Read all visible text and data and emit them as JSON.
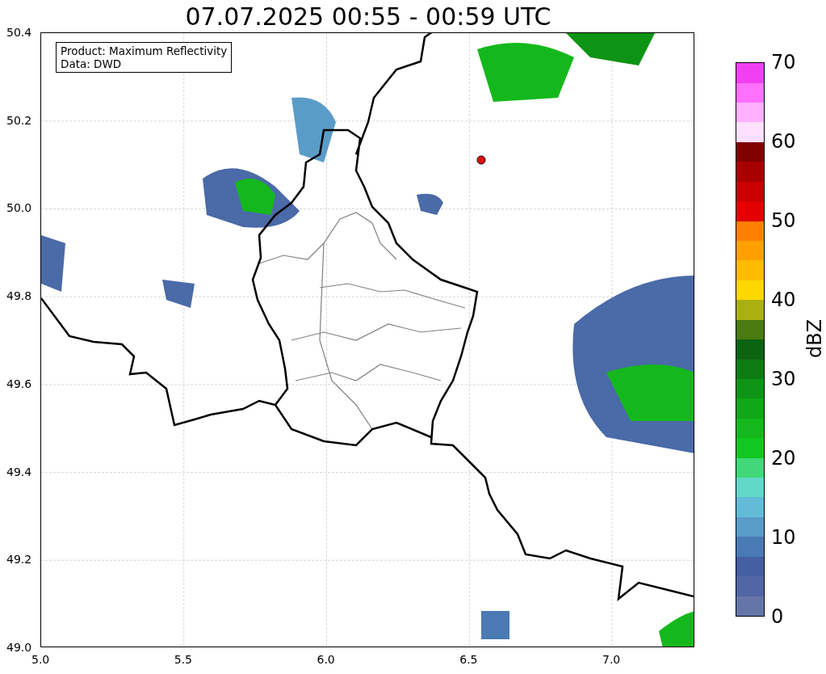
{
  "title": "07.07.2025 00:55 - 00:59 UTC",
  "info_box": [
    "Product: Maximum Reflectivity",
    "Data: DWD"
  ],
  "map": {
    "x_ticks": [
      "5.0",
      "5.5",
      "6.0",
      "6.5",
      "7.0"
    ],
    "y_ticks": [
      "50.4",
      "50.2",
      "50.0",
      "49.8",
      "49.6",
      "49.4",
      "49.2",
      "49.0"
    ]
  },
  "colorbar": {
    "label": "dBZ",
    "ticks": [
      "70",
      "60",
      "50",
      "40",
      "30",
      "20",
      "10",
      "0"
    ],
    "bands": [
      {
        "color": "#6476a8"
      },
      {
        "color": "#5266a4"
      },
      {
        "color": "#4460a0"
      },
      {
        "color": "#4a7ab4"
      },
      {
        "color": "#5a9cc8"
      },
      {
        "color": "#62bcd8"
      },
      {
        "color": "#62d8c8"
      },
      {
        "color": "#40d878"
      },
      {
        "color": "#10c820"
      },
      {
        "color": "#14b81c"
      },
      {
        "color": "#10a818"
      },
      {
        "color": "#0e9414"
      },
      {
        "color": "#0c7c10"
      },
      {
        "color": "#0a6410"
      },
      {
        "color": "#4a7a10"
      },
      {
        "color": "#aab010"
      },
      {
        "color": "#ffd800"
      },
      {
        "color": "#ffbc00"
      },
      {
        "color": "#ffa000"
      },
      {
        "color": "#ff8000"
      },
      {
        "color": "#e40000"
      },
      {
        "color": "#c80000"
      },
      {
        "color": "#a80000"
      },
      {
        "color": "#800000"
      },
      {
        "color": "#ffe0ff"
      },
      {
        "color": "#ffb0ff"
      },
      {
        "color": "#ff70ff"
      },
      {
        "color": "#f040f0"
      }
    ]
  }
}
